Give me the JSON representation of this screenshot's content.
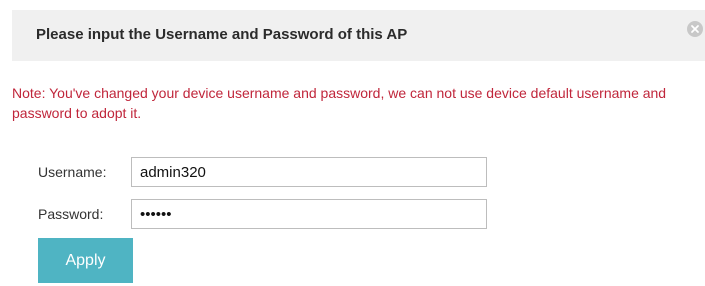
{
  "dialog": {
    "title": "Please input the Username and Password of this AP",
    "close_icon": "close-circle-icon",
    "note": "Note: You've changed your device username and password, we can not use device default username and password to adopt it."
  },
  "form": {
    "username": {
      "label": "Username:",
      "value": "admin320"
    },
    "password": {
      "label": "Password:",
      "value": "••••••"
    },
    "apply_label": "Apply"
  },
  "colors": {
    "header_background": "#f0f0f0",
    "note_text": "#c0263b",
    "apply_button": "#4fb4c3",
    "close_icon": "#c8c8c8"
  }
}
